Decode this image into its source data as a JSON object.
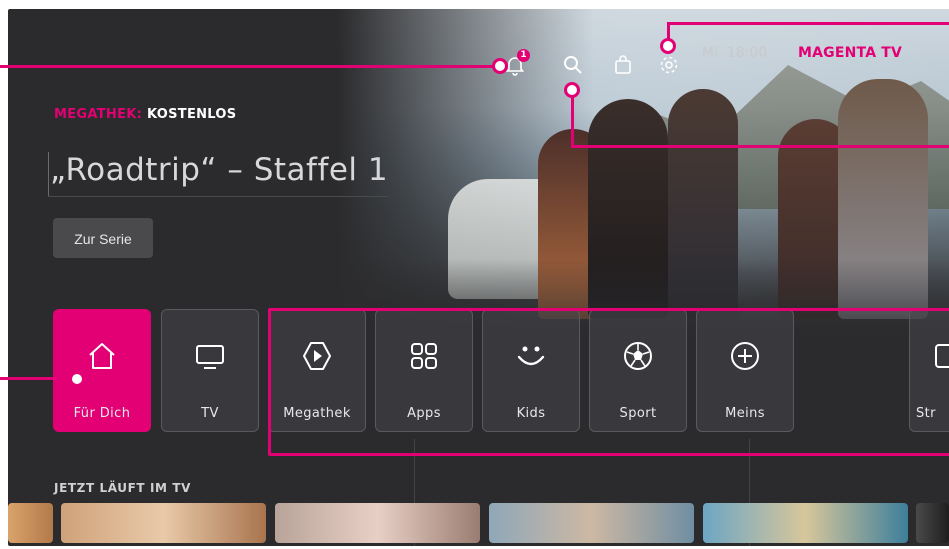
{
  "colors": {
    "accent": "#e20074",
    "background": "#2b2b2d",
    "tile_bg": "#46464a"
  },
  "topbar": {
    "notification_count": "1",
    "time": "Mi. 18:00",
    "brand": "MAGENTA TV",
    "icons": [
      "bell-icon",
      "search-icon",
      "shopping-bag-icon",
      "gear-icon"
    ]
  },
  "hero": {
    "eyebrow_accent": "MEGATHEK:",
    "eyebrow_text": "KOSTENLOS",
    "title": "„Roadtrip“ – Staffel 1",
    "cta_label": "Zur Serie"
  },
  "nav": {
    "items": [
      {
        "label": "Für Dich",
        "icon": "home-icon",
        "active": true
      },
      {
        "label": "TV",
        "icon": "tv-icon"
      },
      {
        "label": "Megathek",
        "icon": "play-icon"
      },
      {
        "label": "Apps",
        "icon": "apps-grid-icon"
      },
      {
        "label": "Kids",
        "icon": "smile-icon"
      },
      {
        "label": "Sport",
        "icon": "soccer-ball-icon"
      },
      {
        "label": "Meins",
        "icon": "plus-circle-icon"
      },
      {
        "label": "Str",
        "icon": "stream-icon"
      }
    ]
  },
  "row": {
    "title": "JETZT LÄUFT IM TV"
  }
}
